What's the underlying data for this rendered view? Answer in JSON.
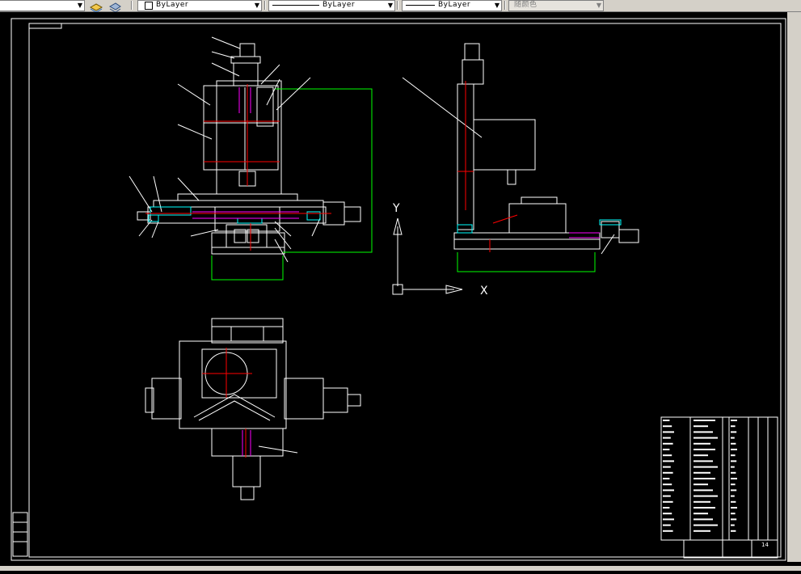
{
  "toolbar": {
    "layer_dropdown_value": "",
    "color_dropdown_value": "ByLayer",
    "linetype_dropdown_value": "ByLayer",
    "lineweight_dropdown_value": "ByLayer",
    "plotstyle_dropdown_value": "随颜色",
    "colors": {
      "face": "#d4d0c8",
      "shadow": "#808080"
    }
  },
  "drawing": {
    "background": "#000000",
    "line_color": "#ffffff",
    "accent_colors": {
      "red": "#ff0000",
      "green": "#00ff00",
      "cyan": "#00ffff",
      "magenta": "#ff00ff"
    },
    "ucs": {
      "x_label": "X",
      "y_label": "Y"
    },
    "title_block_text": "14"
  }
}
